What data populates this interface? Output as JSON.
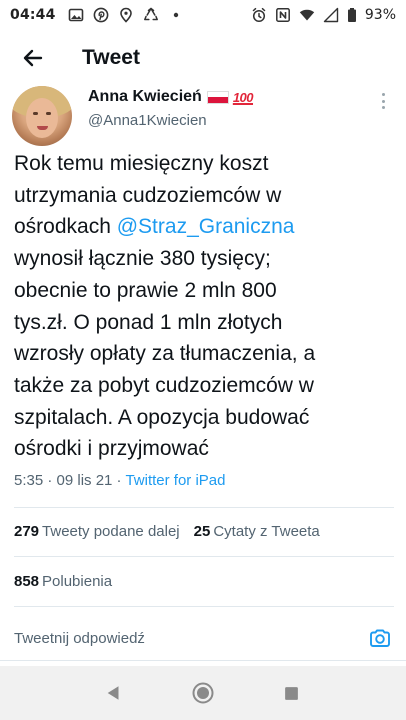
{
  "status_bar": {
    "time": "04:44",
    "left_icons": [
      "image-icon",
      "pinterest-icon",
      "location-icon",
      "recycle-icon",
      "dot-icon"
    ],
    "right_icons": [
      "alarm-icon",
      "nfc-icon",
      "wifi-icon",
      "signal-icon"
    ],
    "battery": "93%"
  },
  "app_bar": {
    "title": "Tweet"
  },
  "author": {
    "name": "Anna Kwiecień",
    "emoji_text": "100",
    "handle": "@Anna1Kwiecien"
  },
  "tweet": {
    "lines": [
      "Rok temu miesięczny koszt",
      "utrzymania cudzoziemców w",
      "ośrodkach ",
      "wynosił łącznie 380 tysięcy;",
      "obecnie to prawie 2 mln 800",
      "tys.zł. O ponad 1 mln złotych",
      "wzrosły opłaty za tłumaczenia, a",
      "także za pobyt cudzoziemców w",
      "szpitalach. A opozycja budować",
      "ośrodki i przyjmować"
    ],
    "mention": "@Straz_Graniczna",
    "timestamp": "5:35 · 09 lis 21 · ",
    "source": "Twitter for iPad"
  },
  "stats": {
    "retweets_count": "279",
    "retweets_label": "Tweety podane dalej",
    "quotes_count": "25",
    "quotes_label": "Cytaty z Tweeta",
    "likes_count": "858",
    "likes_label": "Polubienia"
  },
  "reply": {
    "placeholder": "Tweetnij odpowiedź"
  },
  "colors": {
    "accent": "#1d9bf0",
    "text": "#0f1419",
    "muted": "#536471",
    "divider": "#e1e8ed"
  }
}
